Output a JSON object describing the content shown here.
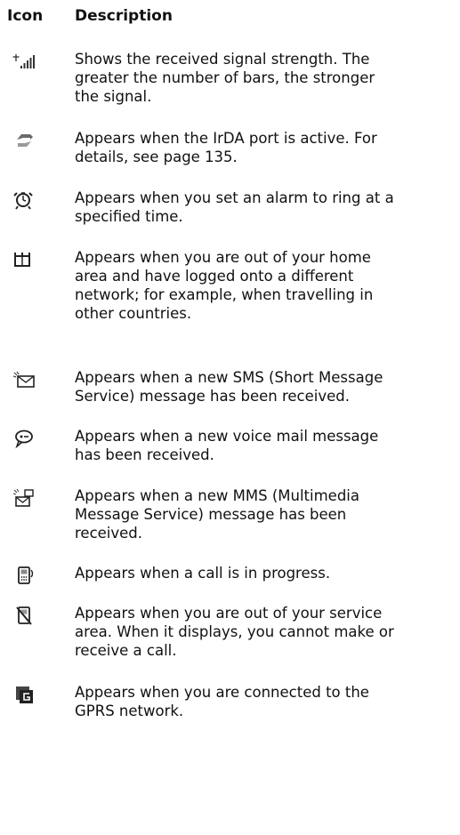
{
  "header": {
    "icon_col": "Icon",
    "desc_col": "Description"
  },
  "rows": [
    {
      "icon": "signal-strength-icon",
      "text": "Shows the received signal strength. The\ngreater the number of bars, the stronger\nthe signal."
    },
    {
      "icon": "irda-icon",
      "text": "Appears when the IrDA port is active. For\ndetails, see page 135."
    },
    {
      "icon": "alarm-clock-icon",
      "text": "Appears when you set an alarm to ring at a\nspecified time."
    },
    {
      "icon": "roaming-icon",
      "text": "Appears when you are out of your home\narea and have logged onto a different\nnetwork; for example, when travelling in\nother countries."
    },
    {
      "icon": "sms-envelope-icon",
      "text": "Appears when a new SMS (Short Message\nService) message has been received."
    },
    {
      "icon": "voice-mail-icon",
      "text": "Appears when a new voice mail message\nhas been received."
    },
    {
      "icon": "mms-icon",
      "text": "Appears when a new MMS (Multimedia\nMessage Service) message has been\nreceived."
    },
    {
      "icon": "call-in-progress-icon",
      "text": "Appears when a call is in progress."
    },
    {
      "icon": "no-service-icon",
      "text": "Appears when you are out of your service\narea. When it displays, you cannot make or\nreceive a call."
    },
    {
      "icon": "gprs-icon",
      "text": "Appears when you are connected to the\nGPRS network."
    }
  ]
}
